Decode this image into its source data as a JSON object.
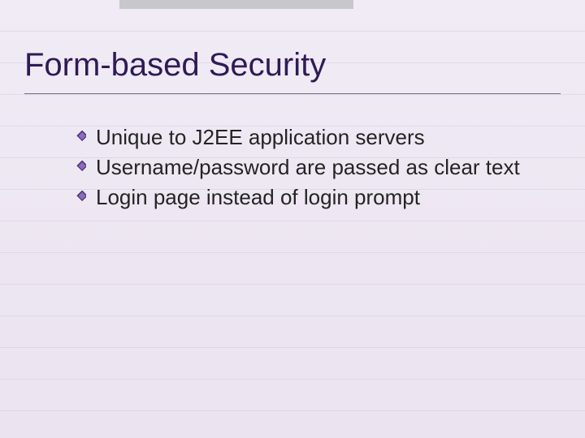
{
  "slide": {
    "title": "Form-based Security",
    "bullets": [
      {
        "text": "Unique to J2EE application servers"
      },
      {
        "text": "Username/password are passed as clear text"
      },
      {
        "text": "Login page instead of login prompt"
      }
    ]
  }
}
